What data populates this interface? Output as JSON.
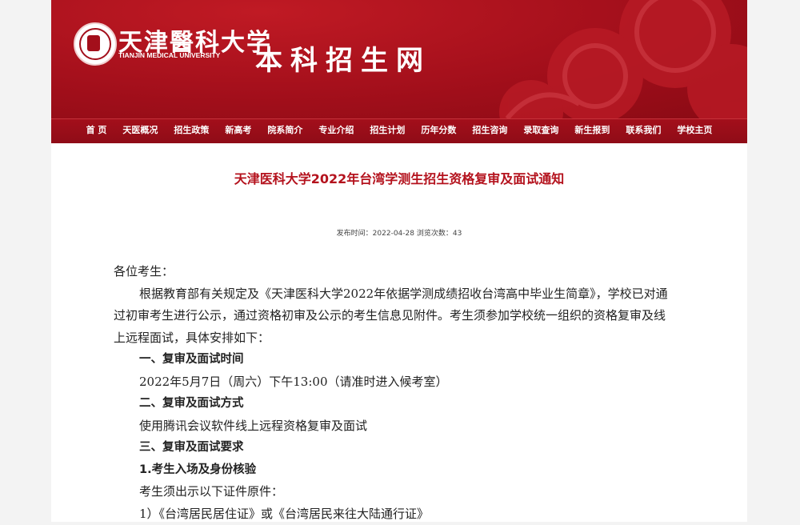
{
  "header": {
    "school_name_cn": "天津醫科大学",
    "school_name_en": "TIANJIN MEDICAL UNIVERSITY",
    "site_title": "本科招生网"
  },
  "nav": [
    "首 页",
    "天医概况",
    "招生政策",
    "新高考",
    "院系简介",
    "专业介绍",
    "招生计划",
    "历年分数",
    "招生咨询",
    "录取查询",
    "新生报到",
    "联系我们",
    "学校主页"
  ],
  "article": {
    "title": "天津医科大学2022年台湾学测生招生资格复审及面试通知",
    "meta": {
      "publish_label": "发布时间：",
      "publish_date": "2022-04-28",
      "views_label": "浏览次数：",
      "views": "43"
    },
    "greeting": "各位考生：",
    "intro": "根据教育部有关规定及《天津医科大学2022年依据学测成绩招收台湾高中毕业生简章》，学校已对通过初审考生进行公示，通过资格初审及公示的考生信息见附件。考生须参加学校统一组织的资格复审及线上远程面试，具体安排如下：",
    "sec1_heading": "一、复审及面试时间",
    "sec1_text": "2022年5月7日（周六）下午13:00（请准时进入候考室）",
    "sec2_heading": "二、复审及面试方式",
    "sec2_text": "使用腾讯会议软件线上远程资格复审及面试",
    "sec3_heading": "三、复审及面试要求",
    "sub1_heading": "1.考生入场及身份核验",
    "sub1_text": "考生须出示以下证件原件：",
    "item1": "1）《台湾居民居住证》或《台湾居民来往大陆通行证》"
  },
  "colors": {
    "brand_red": "#a30f1b",
    "title_red": "#b4121d",
    "page_bg": "#f3f3f3"
  }
}
